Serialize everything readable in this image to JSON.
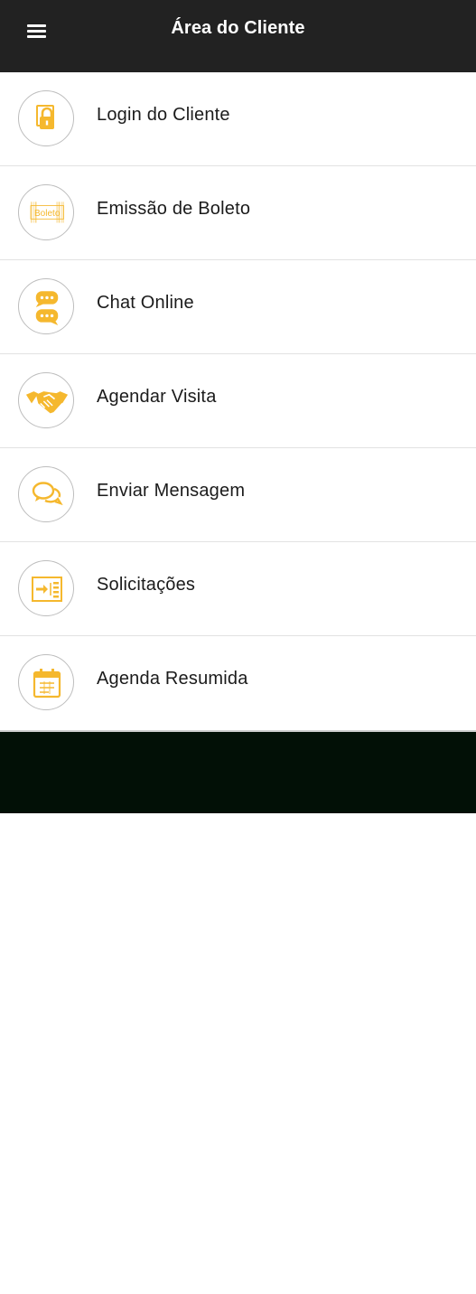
{
  "header": {
    "title": "Área do Cliente",
    "menu_icon": "hamburger-menu-icon"
  },
  "colors": {
    "topbar": "#222222",
    "accent": "#F5B82E",
    "bottom": "#021006"
  },
  "menu_items": [
    {
      "label": "Login do Cliente",
      "icon": "padlock-icon"
    },
    {
      "label": "Emissão de Boleto",
      "icon": "boleto-icon",
      "icon_text": "Boleto"
    },
    {
      "label": "Chat Online",
      "icon": "chat-bubbles-icon"
    },
    {
      "label": "Agendar Visita",
      "icon": "handshake-icon"
    },
    {
      "label": "Enviar Mensagem",
      "icon": "message-bubbles-icon"
    },
    {
      "label": "Solicitações",
      "icon": "request-form-icon"
    },
    {
      "label": "Agenda Resumida",
      "icon": "calendar-icon"
    }
  ]
}
